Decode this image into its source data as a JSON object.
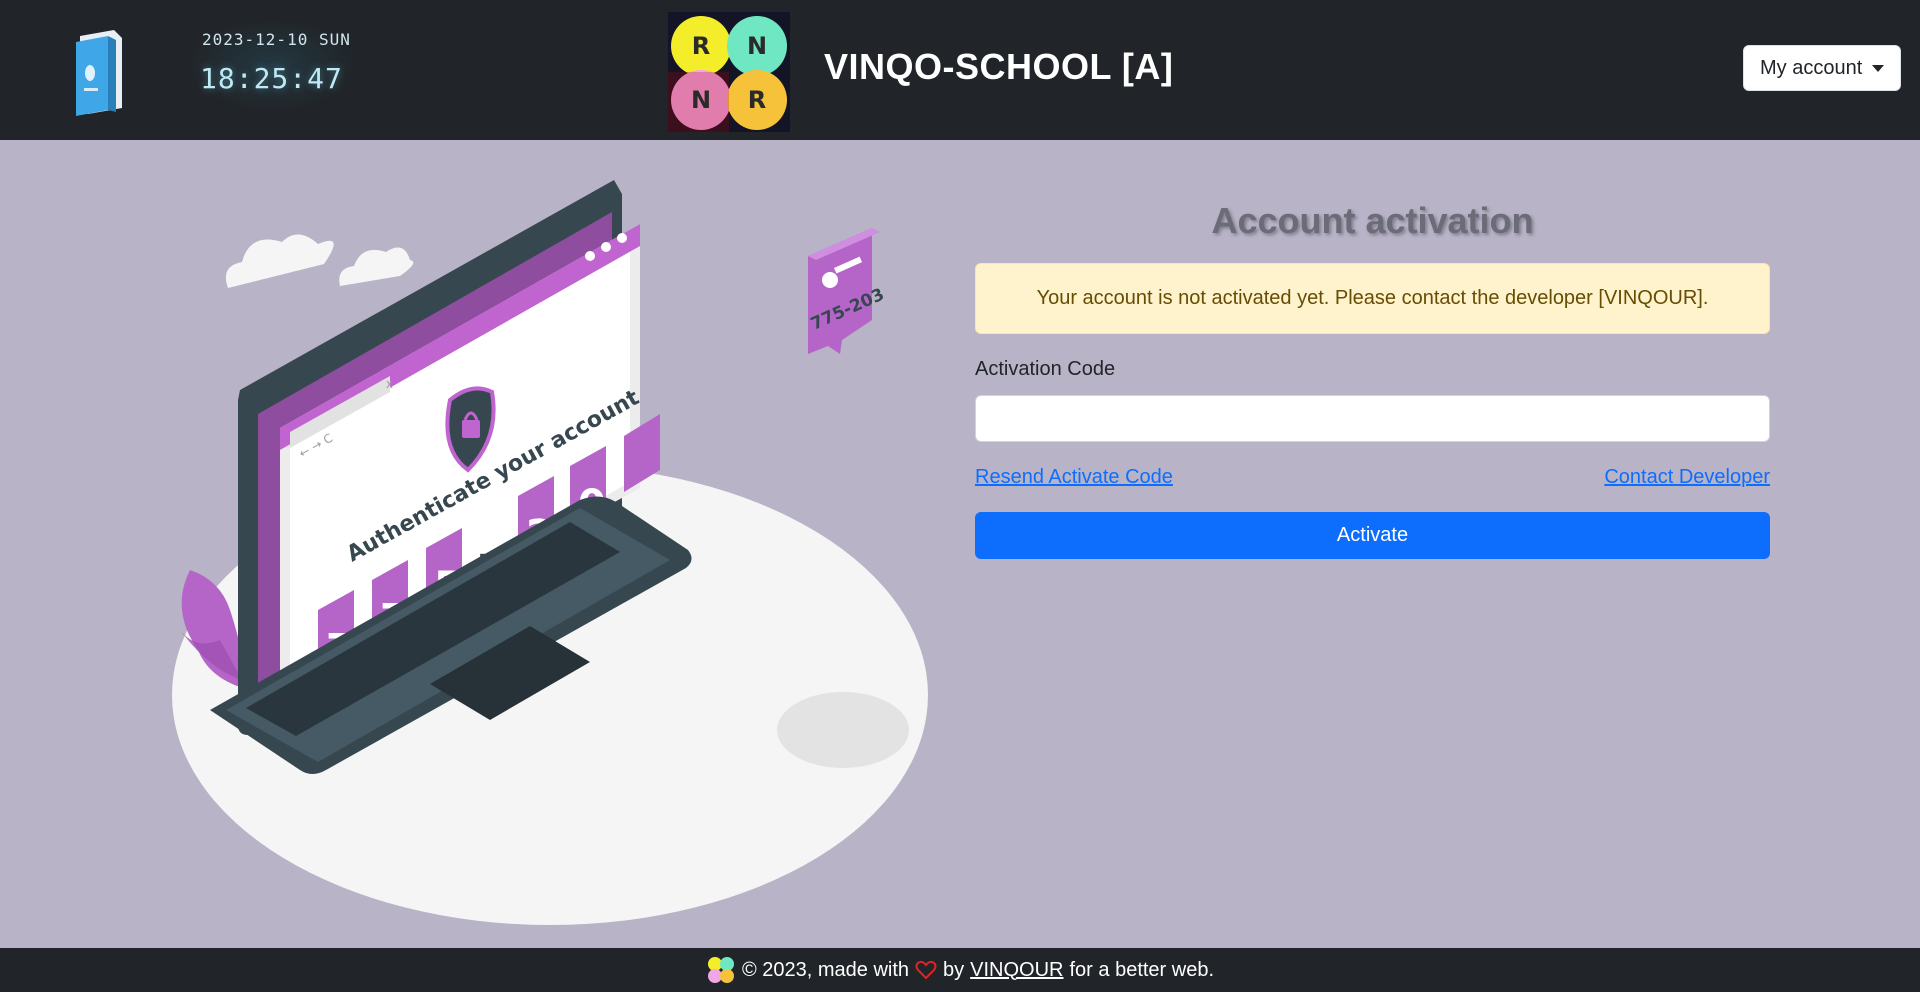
{
  "header": {
    "date": "2023-12-10 SUN",
    "time": "18:25:47",
    "brand": "VINQO-SCHOOL [A]",
    "account_label": "My account",
    "logo_letters": [
      "R",
      "N",
      "N",
      "R"
    ]
  },
  "illustration": {
    "screen_title": "Authenticate your account",
    "browser_nav": "← → C",
    "browser_close": "x",
    "key_code": "775-203",
    "tiles": [
      "7",
      "7",
      "5",
      "-",
      "2",
      "0"
    ]
  },
  "form": {
    "title": "Account activation",
    "alert": "Your account is not activated yet. Please contact the developer [VINQOUR].",
    "code_label": "Activation Code",
    "code_value": "",
    "resend_link": "Resend Activate Code",
    "contact_link": "Contact Developer",
    "activate_button": "Activate"
  },
  "footer": {
    "copyright": "© 2023, made with",
    "by": "by",
    "author": "VINQOUR",
    "tagline": "for a better web."
  },
  "colors": {
    "header_bg": "#212529",
    "page_bg": "#b9b3c8",
    "primary": "#0d6efd",
    "alert_bg": "#fff3cd",
    "accent_purple": "#b565c7",
    "laptop_dark": "#37474f"
  }
}
